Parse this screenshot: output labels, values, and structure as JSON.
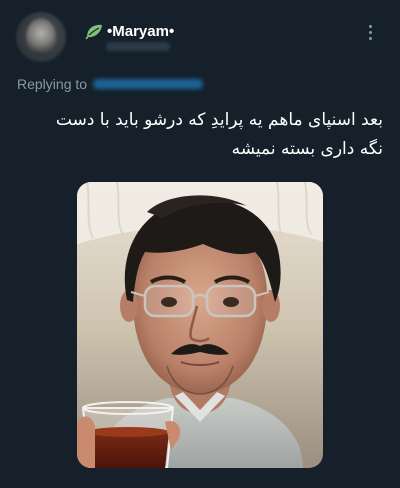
{
  "tweet": {
    "display_name": "•Maryam•",
    "name_icon": "leaf-icon",
    "replying_label": "Replying to",
    "text_line1": "بعد اسنپای ماهم یه پرایدِ که درشو باید با دست",
    "text_line2": "نگه داری بسته نمیشه",
    "more_icon": "more-vertical-icon",
    "media_icon": "photo-man-with-glasses-holding-tea"
  },
  "colors": {
    "background": "#15202b",
    "text_primary": "#ffffff",
    "text_secondary": "#8899a6",
    "link": "#1d9bf0",
    "leaf_green": "#7ec07c"
  }
}
